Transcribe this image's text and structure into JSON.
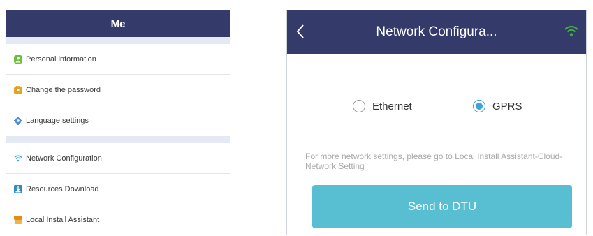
{
  "me_screen": {
    "title": "Me",
    "group1": [
      {
        "label": "Personal information",
        "icon": "person-icon",
        "color": "#6bbf3a"
      },
      {
        "label": "Change the password",
        "icon": "lock-icon",
        "color": "#e7a21f"
      },
      {
        "label": "Language settings",
        "icon": "gear-icon",
        "color": "#4a90d9"
      }
    ],
    "group2": [
      {
        "label": "Network Configuration",
        "icon": "wifi-icon",
        "color": "#3aa7e0"
      },
      {
        "label": "Resources Download",
        "icon": "download-icon",
        "color": "#2e8bc0"
      },
      {
        "label": "Local Install Assistant",
        "icon": "assistant-icon",
        "color": "#e88a1a"
      }
    ]
  },
  "network_screen": {
    "title": "Network Configura...",
    "options": [
      {
        "label": "Ethernet",
        "selected": false
      },
      {
        "label": "GPRS",
        "selected": true
      }
    ],
    "hint": "For more network settings, please go to Local Install Assistant-Cloud-Network Setting",
    "send_label": "Send to DTU"
  },
  "colors": {
    "header": "#343a6a",
    "accent": "#3da3d8",
    "button": "#58bfd3",
    "wifi_status": "#3fae3f"
  }
}
